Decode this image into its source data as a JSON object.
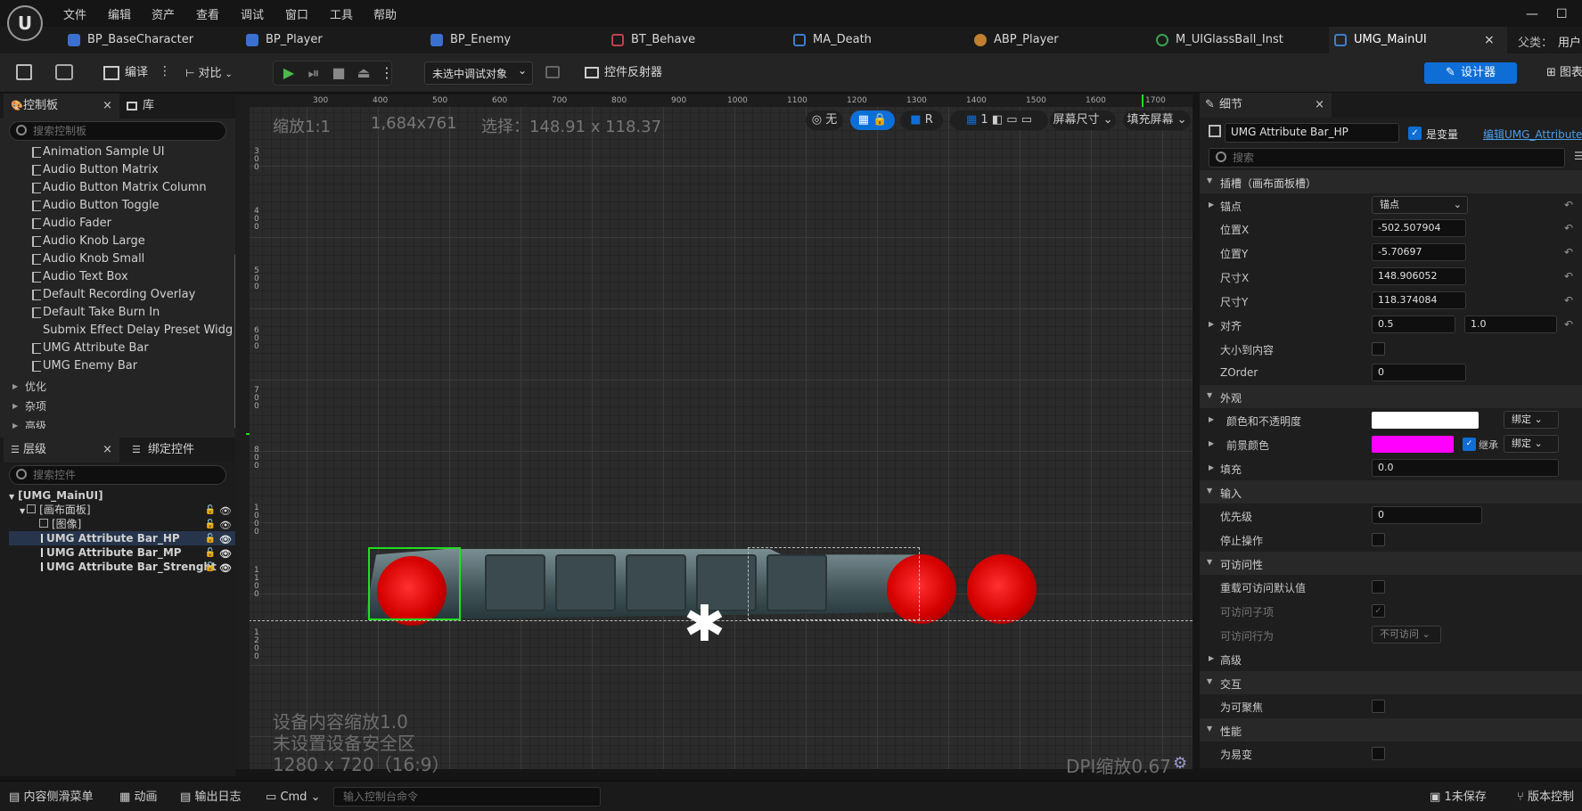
{
  "menu": {
    "logo": "U",
    "items": [
      "文件",
      "编辑",
      "资产",
      "查看",
      "调试",
      "窗口",
      "工具",
      "帮助"
    ]
  },
  "tabs": [
    {
      "label": "BP_BaseCharacter",
      "icon": "blueprint-character-icon"
    },
    {
      "label": "BP_Player",
      "icon": "blueprint-character-icon"
    },
    {
      "label": "BP_Enemy",
      "icon": "blueprint-character-icon"
    },
    {
      "label": "BT_Behave",
      "icon": "behavior-tree-icon"
    },
    {
      "label": "MA_Death",
      "icon": "montage-icon"
    },
    {
      "label": "ABP_Player",
      "icon": "anim-blueprint-icon"
    },
    {
      "label": "M_UIGlassBall_Inst",
      "icon": "material-instance-icon"
    },
    {
      "label": "UMG_MainUI",
      "icon": "widget-blueprint-icon",
      "close": "×"
    }
  ],
  "parent_class_label": "父类：",
  "parent_class_value": "用户",
  "toolbar": {
    "compile": "编译",
    "diff": "对比",
    "debug_object": "未选中调试对象",
    "widget_reflector": "控件反射器",
    "designer": "设计器",
    "graph": "图表"
  },
  "palette": {
    "tab_label": "控制板",
    "library_label": "库",
    "search_placeholder": "搜索控制板",
    "items": [
      "Animation Sample UI",
      "Audio Button Matrix",
      "Audio Button Matrix Column",
      "Audio Button Toggle",
      "Audio Fader",
      "Audio Knob Large",
      "Audio Knob Small",
      "Audio Text Box",
      "Default Recording Overlay",
      "Default Take Burn In",
      "Submix Effect Delay Preset Widget",
      "UMG Attribute Bar",
      "UMG Enemy Bar"
    ],
    "categories": [
      "优化",
      "杂项",
      "高级"
    ]
  },
  "hierarchy": {
    "tab_label": "层级",
    "bind_tab_label": "绑定控件",
    "search_placeholder": "搜索控件",
    "root": "[UMG_MainUI]",
    "canvas": "[画布面板]",
    "image": "[图像]",
    "items": [
      "UMG Attribute Bar_HP",
      "UMG Attribute Bar_MP",
      "UMG Attribute Bar_Strenght"
    ]
  },
  "canvas": {
    "zoom": "缩放1:1",
    "resolution": "1,684x761",
    "selection": "选择：148.91 x 118.37",
    "ruler_ticks": [
      "300",
      "400",
      "500",
      "600",
      "700",
      "800",
      "900",
      "1000",
      "1100",
      "1200",
      "1300",
      "1400",
      "1500",
      "1600",
      "1700"
    ],
    "vertical_ticks": [
      "3\n0\n0",
      "4\n0\n0",
      "5\n0\n0",
      "6\n0\n0",
      "7\n0\n0",
      "8\n0\n0",
      "1\n0\n0\n0",
      "1\n1\n0\n0",
      "1\n2\n0\n0"
    ],
    "none_label": "无",
    "r_label": "R",
    "grid_value": "1",
    "screen_size": "屏幕尺寸",
    "fill_screen": "填充屏幕",
    "device_scale": "设备内容缩放1.0",
    "safe_zone": "未设置设备安全区",
    "device_res": "1280 x 720（16:9）",
    "dpi": "DPI缩放0.67"
  },
  "details": {
    "tab_label": "细节",
    "widget_name": "UMG Attribute Bar_HP",
    "is_variable": "是变量",
    "edit_link": "编辑UMG_AttributeB",
    "search_placeholder": "搜索",
    "slot_section": "插槽（画布面板槽）",
    "anchor_label": "锚点",
    "anchor_value": "锚点",
    "pos_x_label": "位置X",
    "pos_x": "-502.507904",
    "pos_y_label": "位置Y",
    "pos_y": "-5.70697",
    "size_x_label": "尺寸X",
    "size_x": "148.906052",
    "size_y_label": "尺寸Y",
    "size_y": "118.374084",
    "align_label": "对齐",
    "align_x": "0.5",
    "align_y": "1.0",
    "size_to_content": "大小到内容",
    "zorder_label": "ZOrder",
    "zorder": "0",
    "appearance_section": "外观",
    "color_opacity": "颜色和不透明度",
    "bind_label": "绑定",
    "fg_color": "前景颜色",
    "inherit": "继承",
    "padding": "填充",
    "padding_value": "0.0",
    "input_section": "输入",
    "priority": "优先级",
    "priority_value": "0",
    "stop_action": "停止操作",
    "accessibility_section": "可访问性",
    "override_access": "重载可访问默认值",
    "access_children": "可访问子项",
    "access_behavior": "可访问行为",
    "access_behavior_value": "不可访问",
    "advanced": "高级",
    "interaction_section": "交互",
    "focusable": "为可聚焦",
    "performance_section": "性能",
    "volatile": "为易变",
    "color_white": "#ffffff",
    "color_magenta": "#ff00ff"
  },
  "statusbar": {
    "content_drawer": "内容侧滑菜单",
    "animation": "动画",
    "output_log": "输出日志",
    "cmd": "Cmd",
    "console_placeholder": "输入控制台命令",
    "unsaved": "1未保存",
    "source_control": "版本控制"
  },
  "colors": {
    "accent_blue": "#0e6ed6",
    "selection_green": "#22dd22"
  }
}
